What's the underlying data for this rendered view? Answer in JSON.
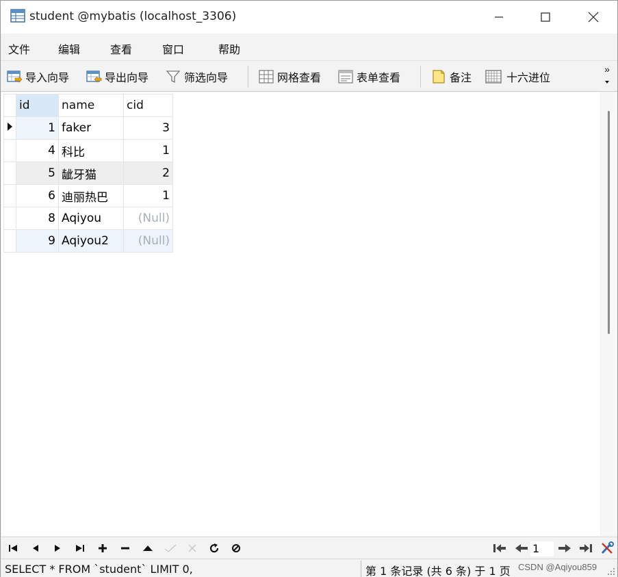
{
  "window": {
    "title": "student @mybatis (localhost_3306)"
  },
  "menu": [
    "文件",
    "编辑",
    "查看",
    "窗口",
    "帮助"
  ],
  "toolbar": {
    "import_wizard": "导入向导",
    "export_wizard": "导出向导",
    "filter_wizard": "筛选向导",
    "grid_view": "网格查看",
    "form_view": "表单查看",
    "memo": "备注",
    "hex": "十六进位",
    "more": "»"
  },
  "table": {
    "columns": [
      "id",
      "name",
      "cid"
    ],
    "rows": [
      {
        "id": "1",
        "name": "faker",
        "cid": "3"
      },
      {
        "id": "4",
        "name": "科比",
        "cid": "1"
      },
      {
        "id": "5",
        "name": "龇牙猫",
        "cid": "2"
      },
      {
        "id": "6",
        "name": "迪丽热巴",
        "cid": "1"
      },
      {
        "id": "8",
        "name": "Aqiyou",
        "cid": "(Null)"
      },
      {
        "id": "9",
        "name": "Aqiyou2",
        "cid": "(Null)"
      }
    ]
  },
  "navigation": {
    "page": "1"
  },
  "status": {
    "sql": "SELECT * FROM `student` LIMIT 0,",
    "record_info": "第 1 条记录 (共 6 条) 于 1 页",
    "watermark": "CSDN @Aqiyou859"
  },
  "colors": {
    "selected_header": "#d9e8f7",
    "selected_row": "#edf4fc",
    "null_text": "#a9b0b8"
  }
}
